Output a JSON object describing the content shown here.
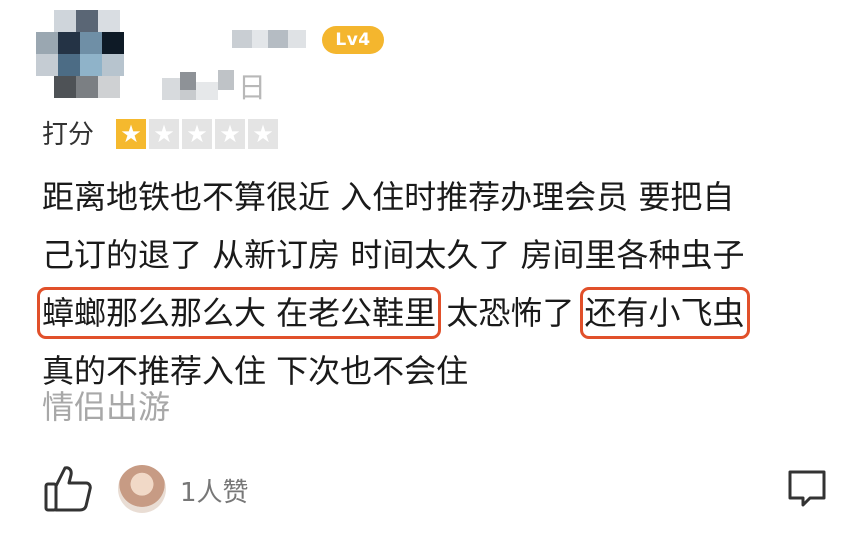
{
  "user": {
    "level": "Lv4",
    "date_suffix": "日"
  },
  "rating": {
    "label": "打分",
    "score": 1,
    "max": 5
  },
  "review": {
    "lines": [
      [
        {
          "text": "距离地铁也不算很近 入住时推荐办理会员 要把自",
          "highlight": false
        }
      ],
      [
        {
          "text": "己订的退了 从新订房 时间太久了 房间里各种虫子",
          "highlight": false
        }
      ],
      [
        {
          "text": "蟑螂那么那么大 在老公鞋里",
          "highlight": true
        },
        {
          "text": " 太恐怖了 ",
          "highlight": false
        },
        {
          "text": "还有小飞虫",
          "highlight": true
        }
      ],
      [
        {
          "text": "真的不推荐入住 下次也不会住",
          "highlight": false
        }
      ]
    ],
    "tag": "情侣出游"
  },
  "footer": {
    "like_count": "1人赞"
  },
  "colors": {
    "level_badge": "#f4b62e",
    "star_on": "#f5b92e",
    "star_off": "#e4e4e4",
    "highlight_border": "#e1502a",
    "muted_text": "#a8a8a8"
  },
  "icons": {
    "like": "thumbs-up-icon",
    "comment": "comment-icon",
    "star": "star-icon"
  }
}
